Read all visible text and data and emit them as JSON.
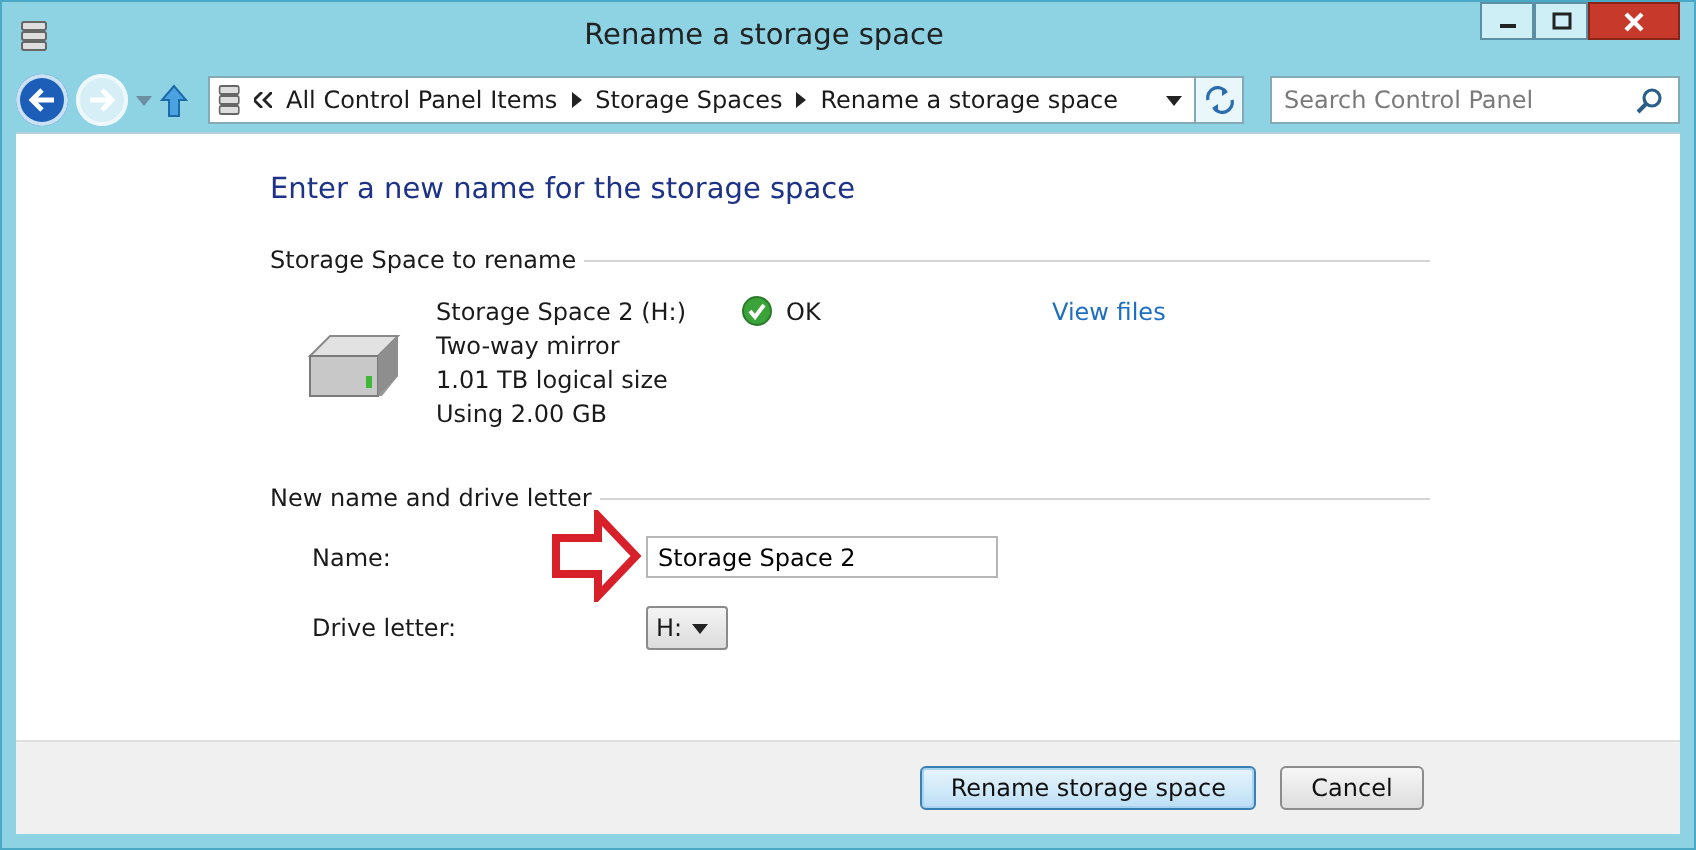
{
  "window": {
    "title": "Rename a storage space"
  },
  "navigation": {
    "back_enabled": true,
    "forward_enabled": false
  },
  "address_bar": {
    "breadcrumbs": [
      "All Control Panel Items",
      "Storage Spaces",
      "Rename a storage space"
    ]
  },
  "search": {
    "placeholder": "Search Control Panel"
  },
  "heading": "Enter a new name for the storage space",
  "rename_section": {
    "title": "Storage Space to rename",
    "lines": [
      "Storage Space 2 (H:)",
      "Two-way mirror",
      "1.01 TB logical size",
      "Using 2.00 GB"
    ],
    "status": "OK",
    "link": "View files"
  },
  "new_name_section": {
    "title": "New name and drive letter",
    "name_label": "Name:",
    "name_value": "Storage Space 2",
    "drive_label": "Drive letter:",
    "drive_value": "H:"
  },
  "buttons": [
    {
      "label": "Rename storage space",
      "default": true
    },
    {
      "label": "Cancel",
      "default": false
    }
  ]
}
